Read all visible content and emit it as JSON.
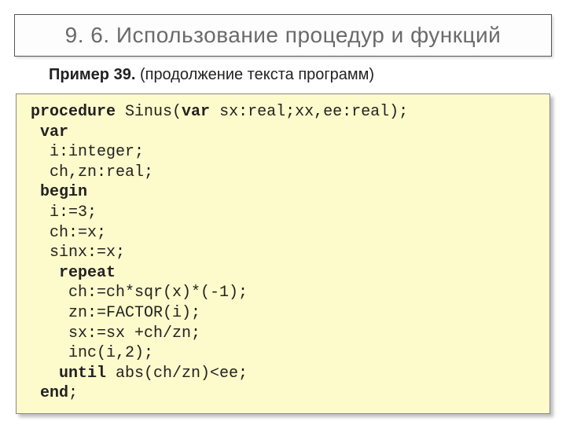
{
  "title": "9. 6. Использование процедур и функций",
  "subtitle_bold": "Пример 39.",
  "subtitle_rest": " (продолжение текста программ)",
  "code": {
    "l01_a": "procedure",
    "l01_b": " Sinus(",
    "l01_c": "var",
    "l01_d": " sx:real;xx,ee:real);",
    "l02_a": " var",
    "l03": "  i:integer;",
    "l04": "  ch,zn:real;",
    "l05_a": " begin",
    "l06": "  i:=3;",
    "l07": "  ch:=x;",
    "l08": "  sinx:=x;",
    "l09_a": "   repeat",
    "l10": "    ch:=ch*sqr(x)*(-1);",
    "l11": "    zn:=FACTOR(i);",
    "l12": "    sx:=sx +ch/zn;",
    "l13": "    inc(i,2);",
    "l14_a": "   until",
    "l14_b": " abs(ch/zn)<ee;",
    "l15_a": " end",
    "l15_b": ";"
  }
}
